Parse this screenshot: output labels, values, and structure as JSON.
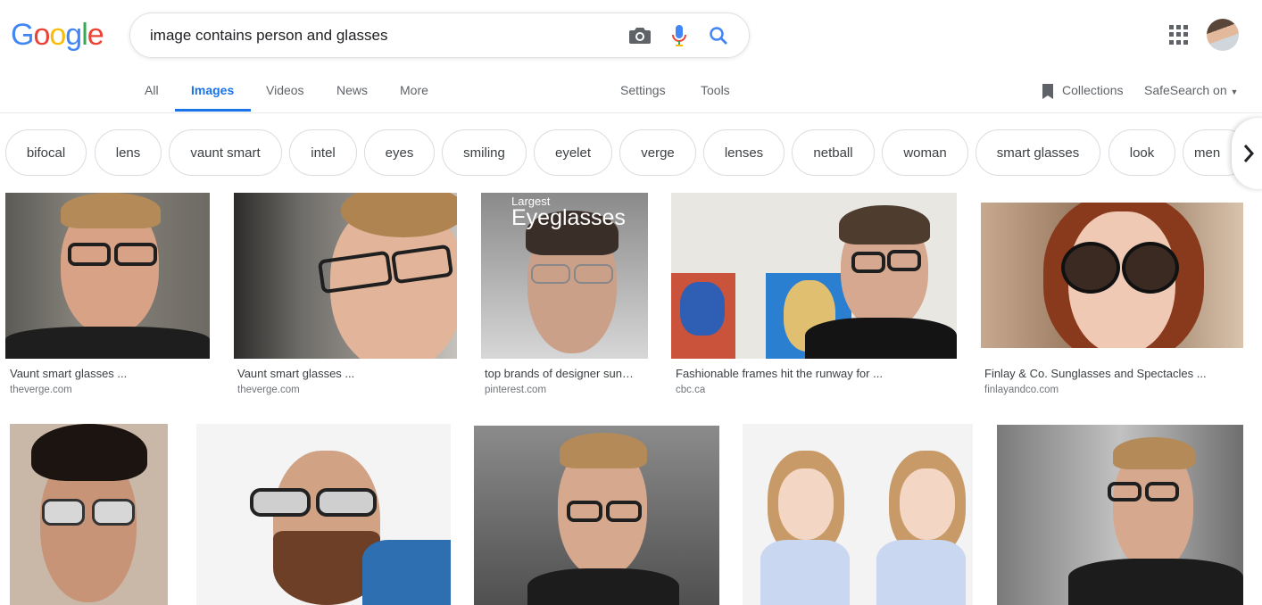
{
  "logo": {
    "text": "Google",
    "colors": [
      "#4285F4",
      "#EA4335",
      "#FBBC05",
      "#4285F4",
      "#34A853",
      "#EA4335"
    ]
  },
  "search": {
    "query": "image contains person and glasses"
  },
  "icons": {
    "camera": "camera-icon",
    "mic": "microphone-icon",
    "search": "search-icon",
    "apps": "apps-grid-icon",
    "collections": "bookmark-icon",
    "chevron": "chevron-right-icon"
  },
  "tabs": {
    "all": "All",
    "images": "Images",
    "videos": "Videos",
    "news": "News",
    "more": "More",
    "settings": "Settings",
    "tools": "Tools",
    "collections": "Collections",
    "safesearch": "SafeSearch on"
  },
  "chips": [
    "bifocal",
    "lens",
    "vaunt smart",
    "intel",
    "eyes",
    "smiling",
    "eyelet",
    "verge",
    "lenses",
    "netball",
    "woman",
    "smart glasses",
    "look",
    "men"
  ],
  "results": [
    {
      "caption": "Vaunt smart glasses ...",
      "source": "theverge.com"
    },
    {
      "caption": "Vaunt smart glasses ...",
      "source": "theverge.com"
    },
    {
      "caption": "top brands of designer sun…",
      "source": "pinterest.com",
      "overlay_small": "Largest",
      "overlay_big": "Eyeglasses"
    },
    {
      "caption": "Fashionable frames hit the runway for ...",
      "source": "cbc.ca"
    },
    {
      "caption": "Finlay & Co. Sunglasses and Spectacles ...",
      "source": "finlayandco.com"
    }
  ],
  "colors": {
    "accent": "#1a73e8",
    "text": "#202124",
    "muted": "#5f6368",
    "source": "#70757a"
  }
}
